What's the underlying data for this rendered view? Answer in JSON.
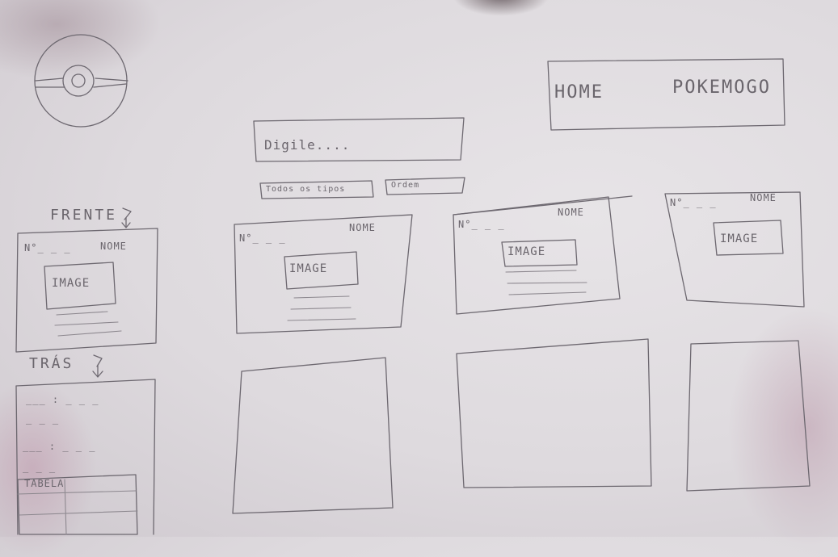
{
  "nav": {
    "home": "HOME",
    "pokemon": "POKEMOGO"
  },
  "search": {
    "placeholder": "Digile....",
    "types_button": "Todos os tipos",
    "order_button": "Ordem"
  },
  "labels": {
    "front": "FRENTE",
    "back": "TRÁS",
    "table": "TABELA"
  },
  "card": {
    "number": "N°_ _ _",
    "name": "NOME",
    "image": "IMAGE"
  },
  "back_card": {
    "row_a": "___ : _ _ _",
    "row_b": "_ _ _"
  },
  "icons": {
    "logo": "pokeball-icon",
    "arrow": "arrow-down-icon"
  }
}
